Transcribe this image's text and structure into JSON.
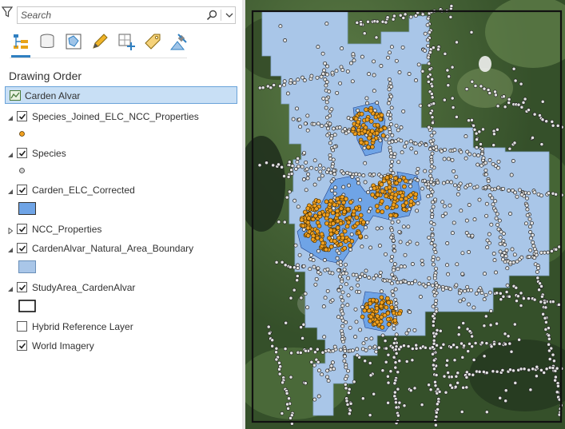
{
  "search": {
    "placeholder": "Search"
  },
  "toolbar": {
    "tools": [
      {
        "name": "list-by-drawing-order",
        "selected": true
      },
      {
        "name": "list-by-data-source"
      },
      {
        "name": "list-by-selection"
      },
      {
        "name": "list-by-editing"
      },
      {
        "name": "list-by-snapping"
      },
      {
        "name": "list-by-labeling"
      },
      {
        "name": "list-by-perspective-imagery"
      }
    ]
  },
  "contents": {
    "heading": "Drawing Order",
    "map_name": "Carden Alvar",
    "layers": [
      {
        "label": "Species_Joined_ELC_NCC_Properties",
        "checked": true,
        "expanded": true,
        "symbol": "orange-point"
      },
      {
        "label": "Species",
        "checked": true,
        "expanded": true,
        "symbol": "grey-point"
      },
      {
        "label": "Carden_ELC_Corrected",
        "checked": true,
        "expanded": true,
        "symbol": "blue-fill"
      },
      {
        "label": "NCC_Properties",
        "checked": true,
        "expanded": false
      },
      {
        "label": "CardenAlvar_Natural_Area_Boundary",
        "checked": true,
        "expanded": true,
        "symbol": "lightblue-fill"
      },
      {
        "label": "StudyArea_CardenAlvar",
        "checked": true,
        "expanded": true,
        "symbol": "black-outline"
      },
      {
        "label": "Hybrid Reference Layer",
        "checked": false
      },
      {
        "label": "World Imagery",
        "checked": true
      }
    ]
  },
  "colors": {
    "selection_bg": "#c8dff5",
    "accent": "#2f7fc1",
    "boundary_fill": "#a9c6e8",
    "elc_fill": "#6fa4e6",
    "species_point": "#f0a020",
    "imagery_green": "#3e5a30"
  }
}
